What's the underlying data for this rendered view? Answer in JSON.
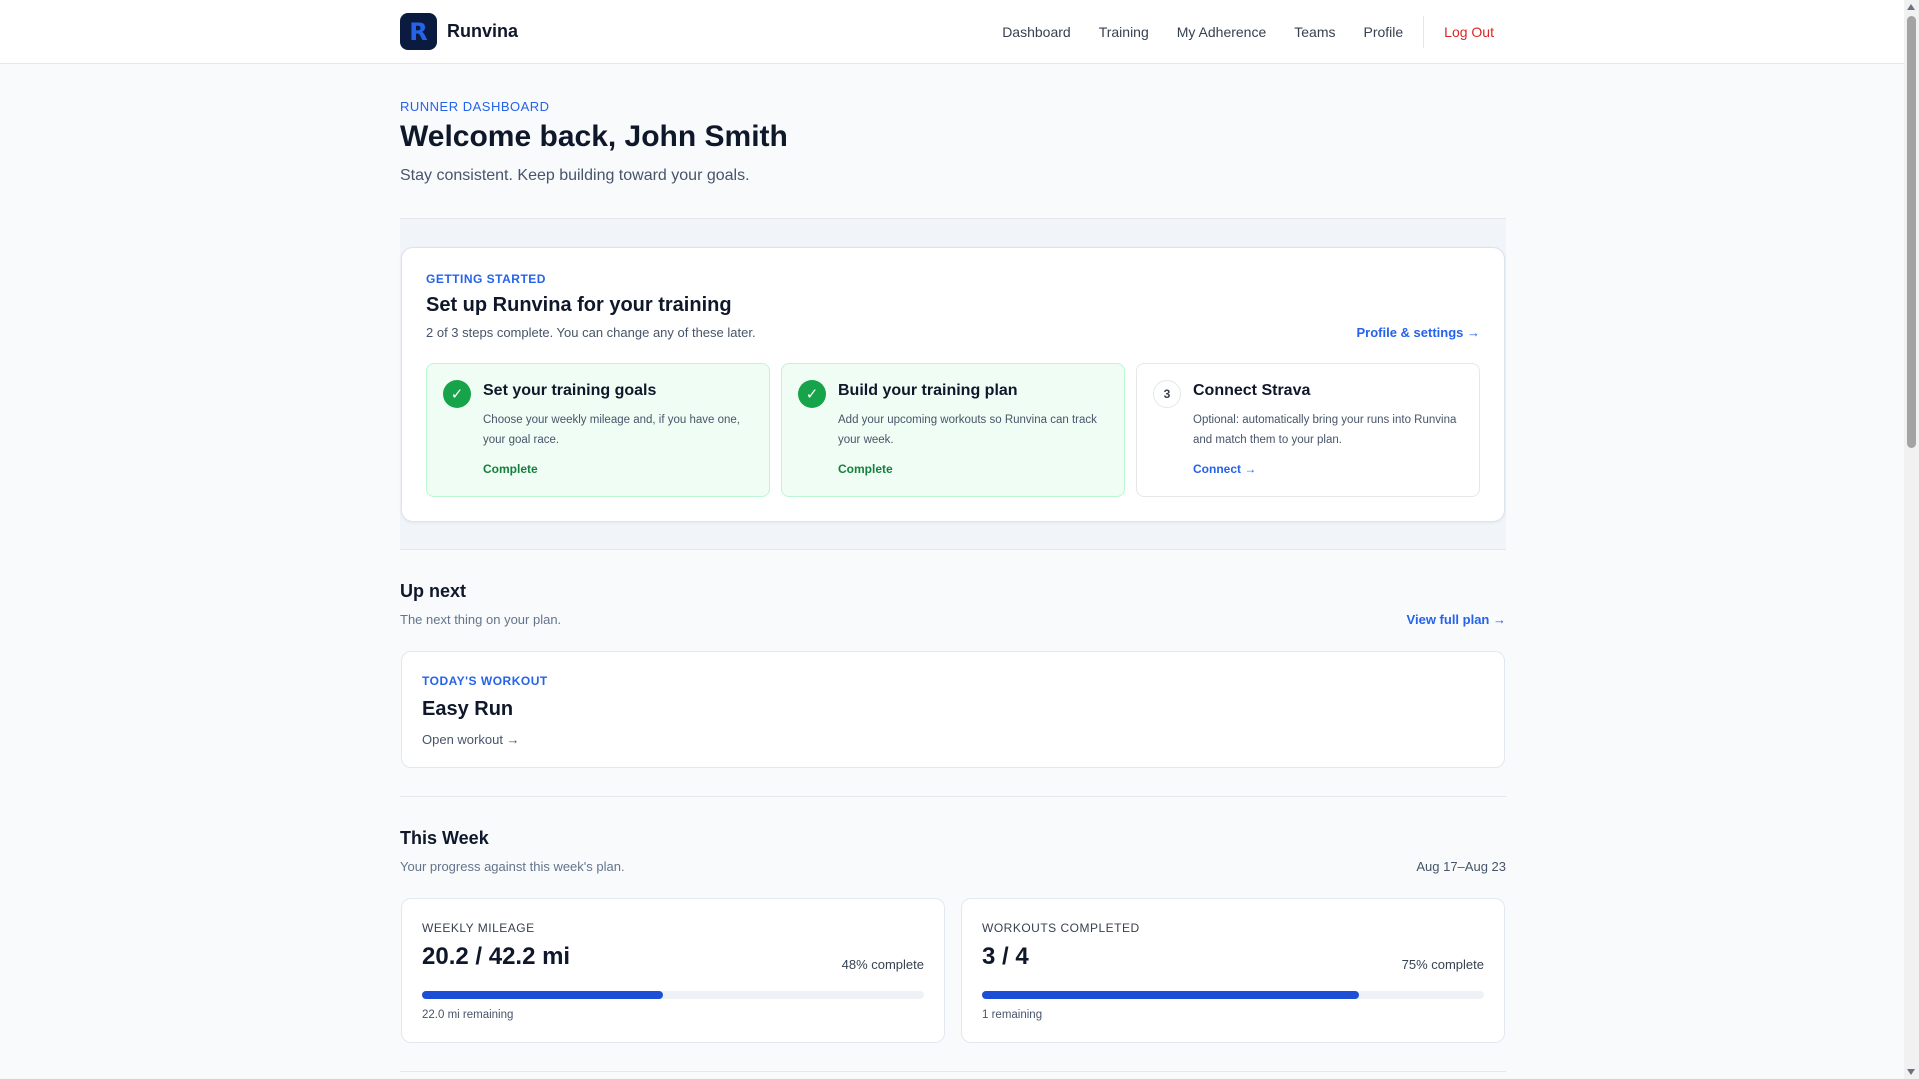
{
  "app": {
    "name": "Runvina",
    "logo_letter": "R"
  },
  "nav": {
    "items": [
      "Dashboard",
      "Training",
      "My Adherence",
      "Teams",
      "Profile"
    ],
    "logout": "Log Out"
  },
  "header": {
    "eyebrow": "RUNNER DASHBOARD",
    "title": "Welcome back, John Smith",
    "subtitle": "Stay consistent. Keep building toward your goals."
  },
  "getting_started": {
    "eyebrow": "GETTING STARTED",
    "title": "Set up Runvina for your training",
    "subtitle": "2 of 3 steps complete. You can change any of these later.",
    "link": "Profile & settings →",
    "steps": [
      {
        "badge": "✓",
        "title": "Set your training goals",
        "desc": "Choose your weekly mileage and, if you have one, your goal race.",
        "status": "Complete"
      },
      {
        "badge": "✓",
        "title": "Build your training plan",
        "desc": "Add your upcoming workouts so Runvina can track your week.",
        "status": "Complete"
      },
      {
        "badge": "3",
        "title": "Connect Strava",
        "desc": "Optional: automatically bring your runs into Runvina and match them to your plan.",
        "status": "Connect →"
      }
    ]
  },
  "up_next": {
    "title": "Up next",
    "subtitle": "The next thing on your plan.",
    "link": "View full plan →",
    "workout": {
      "eyebrow": "TODAY'S WORKOUT",
      "title": "Easy Run",
      "link": "Open workout →"
    }
  },
  "this_week": {
    "title": "This Week",
    "subtitle": "Your progress against this week's plan.",
    "range": "Aug 17–Aug 23",
    "stats": [
      {
        "eyebrow": "WEEKLY MILEAGE",
        "value": "20.2 / 42.2 mi",
        "pct": "48% complete",
        "progress": 0.48,
        "foot": "22.0 mi remaining"
      },
      {
        "eyebrow": "WORKOUTS COMPLETED",
        "value": "3 / 4",
        "pct": "75% complete",
        "progress": 0.75,
        "foot": "1 remaining"
      }
    ]
  },
  "colors": {
    "accent": "#2563eb",
    "success": "#16a34a",
    "danger": "#dc2626",
    "progress": "#1d4ed8"
  }
}
